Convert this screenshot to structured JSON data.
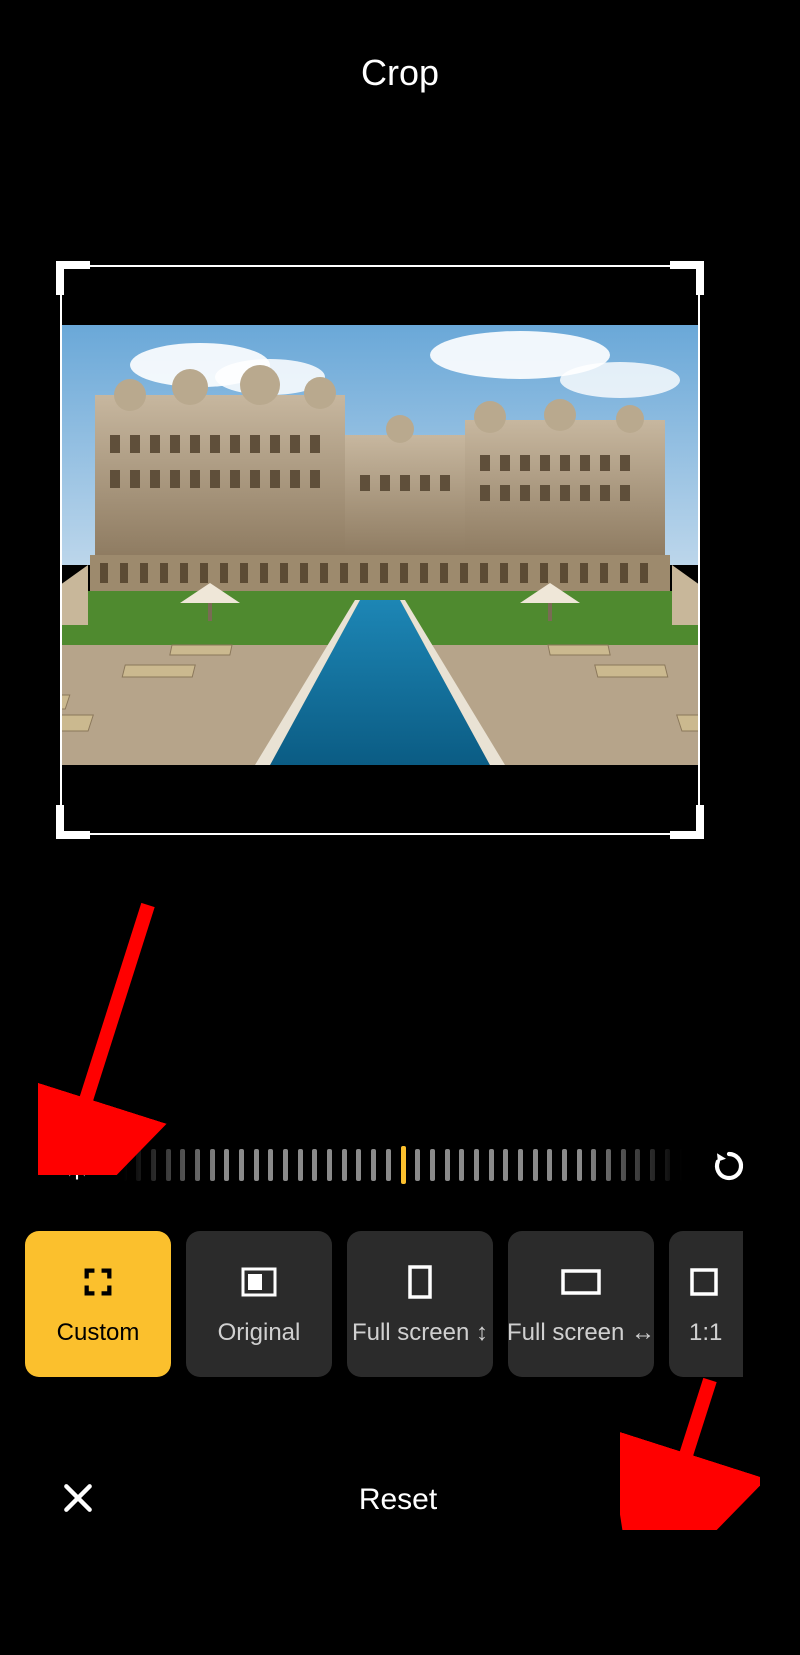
{
  "header": {
    "title": "Crop"
  },
  "ruler": {
    "ticks": 39,
    "center_index": 19
  },
  "ratios": [
    {
      "key": "custom",
      "label": "Custom",
      "active": true
    },
    {
      "key": "original",
      "label": "Original",
      "active": false
    },
    {
      "key": "fullscreen_v",
      "label": "Full screen ↕",
      "active": false
    },
    {
      "key": "fullscreen_h",
      "label": "Full screen ↔",
      "active": false
    },
    {
      "key": "one_one",
      "label": "1:1",
      "active": false
    }
  ],
  "footer": {
    "reset": "Reset"
  },
  "colors": {
    "accent": "#fbc02d"
  }
}
